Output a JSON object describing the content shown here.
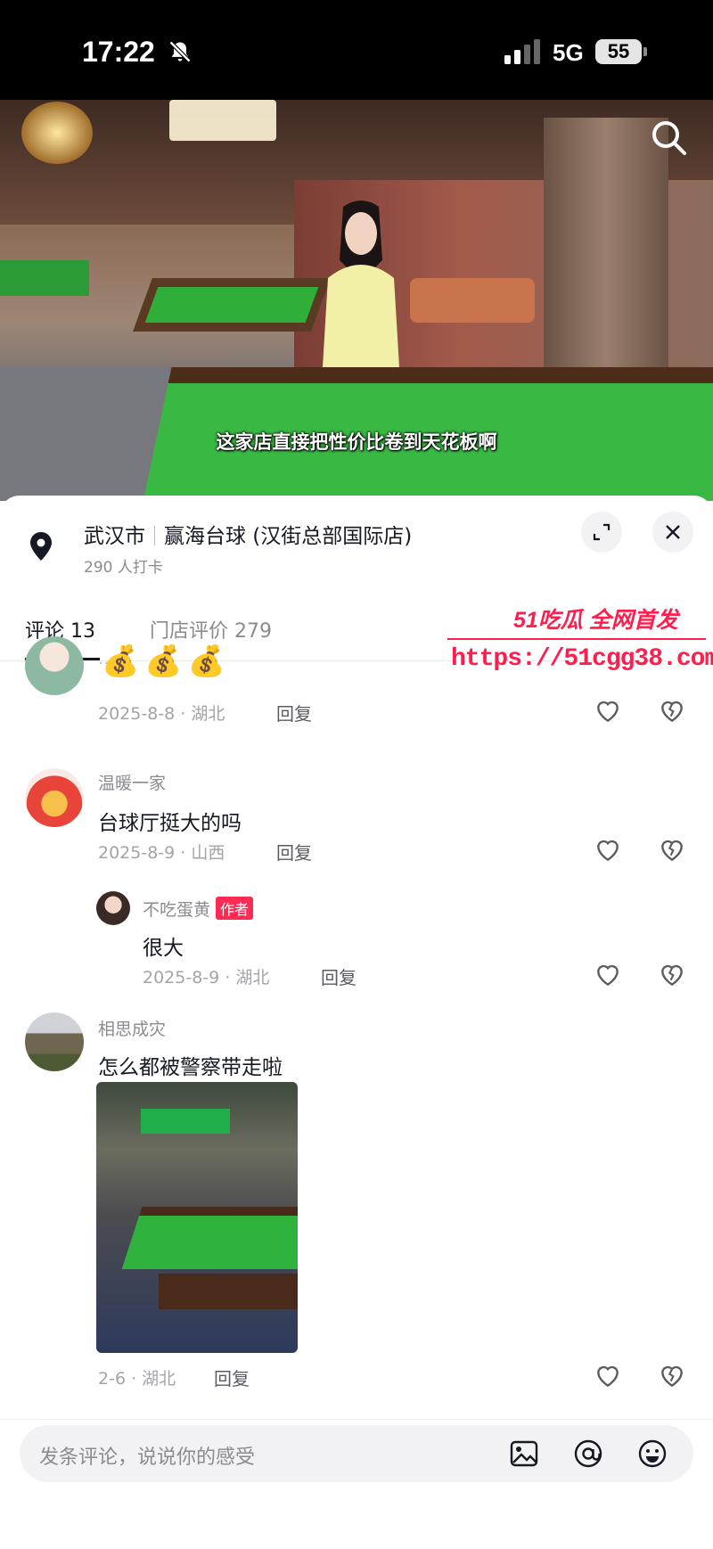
{
  "status_bar": {
    "time": "17:22",
    "network": "5G",
    "battery": "55"
  },
  "video": {
    "caption": "这家店直接把性价比卷到天花板啊"
  },
  "location": {
    "city": "武汉市",
    "store": "赢海台球 (汉街总部国际店)",
    "checkins": "290 人打卡"
  },
  "tabs": [
    {
      "label": "评论 13"
    },
    {
      "label": "门店评价 279"
    }
  ],
  "watermark": {
    "brand": "51吃瓜 全网首发",
    "url": "https://51cgg38.com"
  },
  "comments": [
    {
      "name": "…",
      "emojis": "💰💰💰",
      "date": "2025-8-8 · 湖北",
      "reply_label": "回复"
    },
    {
      "name": "温暖一家",
      "text": "台球厅挺大的吗",
      "date": "2025-8-9 · 山西",
      "reply_label": "回复"
    },
    {
      "name": "不吃蛋黄",
      "author_badge": "作者",
      "text": "很大",
      "date": "2025-8-9 · 湖北",
      "reply_label": "回复"
    },
    {
      "name": "相思成灾",
      "text": "怎么都被警察带走啦",
      "date": "2-6 · 湖北",
      "reply_label": "回复"
    }
  ],
  "input": {
    "placeholder": "发条评论，说说你的感受"
  },
  "colors": {
    "accent": "#fe2c55",
    "watermark": "#ff1e4d",
    "table_green": "#39b844"
  },
  "icons": [
    "bell-off-icon",
    "signal-icon",
    "search-icon",
    "location-pin-icon",
    "expand-icon",
    "close-icon",
    "heart-icon",
    "dislike-icon",
    "image-icon",
    "at-icon",
    "emoji-icon"
  ]
}
